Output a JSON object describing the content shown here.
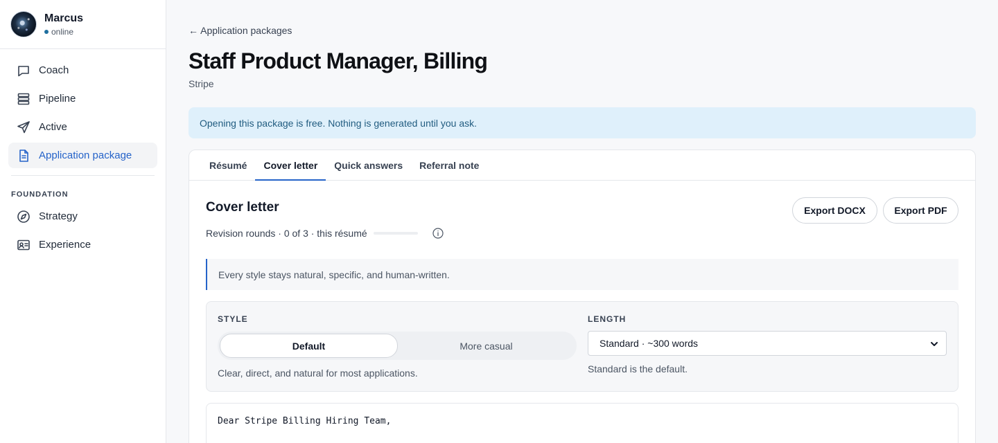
{
  "user": {
    "name": "Marcus",
    "status": "online"
  },
  "sidebar": {
    "items": [
      {
        "label": "Coach",
        "icon": "chat-bubble-icon"
      },
      {
        "label": "Pipeline",
        "icon": "stack-icon"
      },
      {
        "label": "Active",
        "icon": "paper-plane-icon"
      },
      {
        "label": "Application package",
        "icon": "document-icon"
      }
    ],
    "section_label": "FOUNDATION",
    "foundation_items": [
      {
        "label": "Strategy",
        "icon": "compass-icon"
      },
      {
        "label": "Experience",
        "icon": "id-card-icon"
      }
    ]
  },
  "header": {
    "back_link": "← Application packages",
    "title": "Staff Product Manager, Billing",
    "company": "Stripe"
  },
  "banner": "Opening this package is free. Nothing is generated until you ask.",
  "tabs": [
    {
      "label": "Résumé"
    },
    {
      "label": "Cover letter"
    },
    {
      "label": "Quick answers"
    },
    {
      "label": "Referral note"
    }
  ],
  "cover_letter": {
    "title": "Cover letter",
    "revisions": "Revision rounds · 0 of 3 · this résumé",
    "revisions_used": 0,
    "revisions_total": 3,
    "export_docx": "Export DOCX",
    "export_pdf": "Export PDF",
    "note": "Every style stays natural, specific, and human-written.",
    "style": {
      "label": "STYLE",
      "options": [
        "Default",
        "More casual"
      ],
      "help": "Clear, direct, and natural for most applications."
    },
    "length": {
      "label": "LENGTH",
      "value": "Standard · ~300 words",
      "help": "Standard is the default."
    },
    "letter_opening": "Dear Stripe Billing Hiring Team,"
  },
  "colors": {
    "accent": "#2563c9",
    "banner_bg": "#dff0fb",
    "banner_text": "#215c80",
    "status_dot": "#1f6f9f"
  }
}
